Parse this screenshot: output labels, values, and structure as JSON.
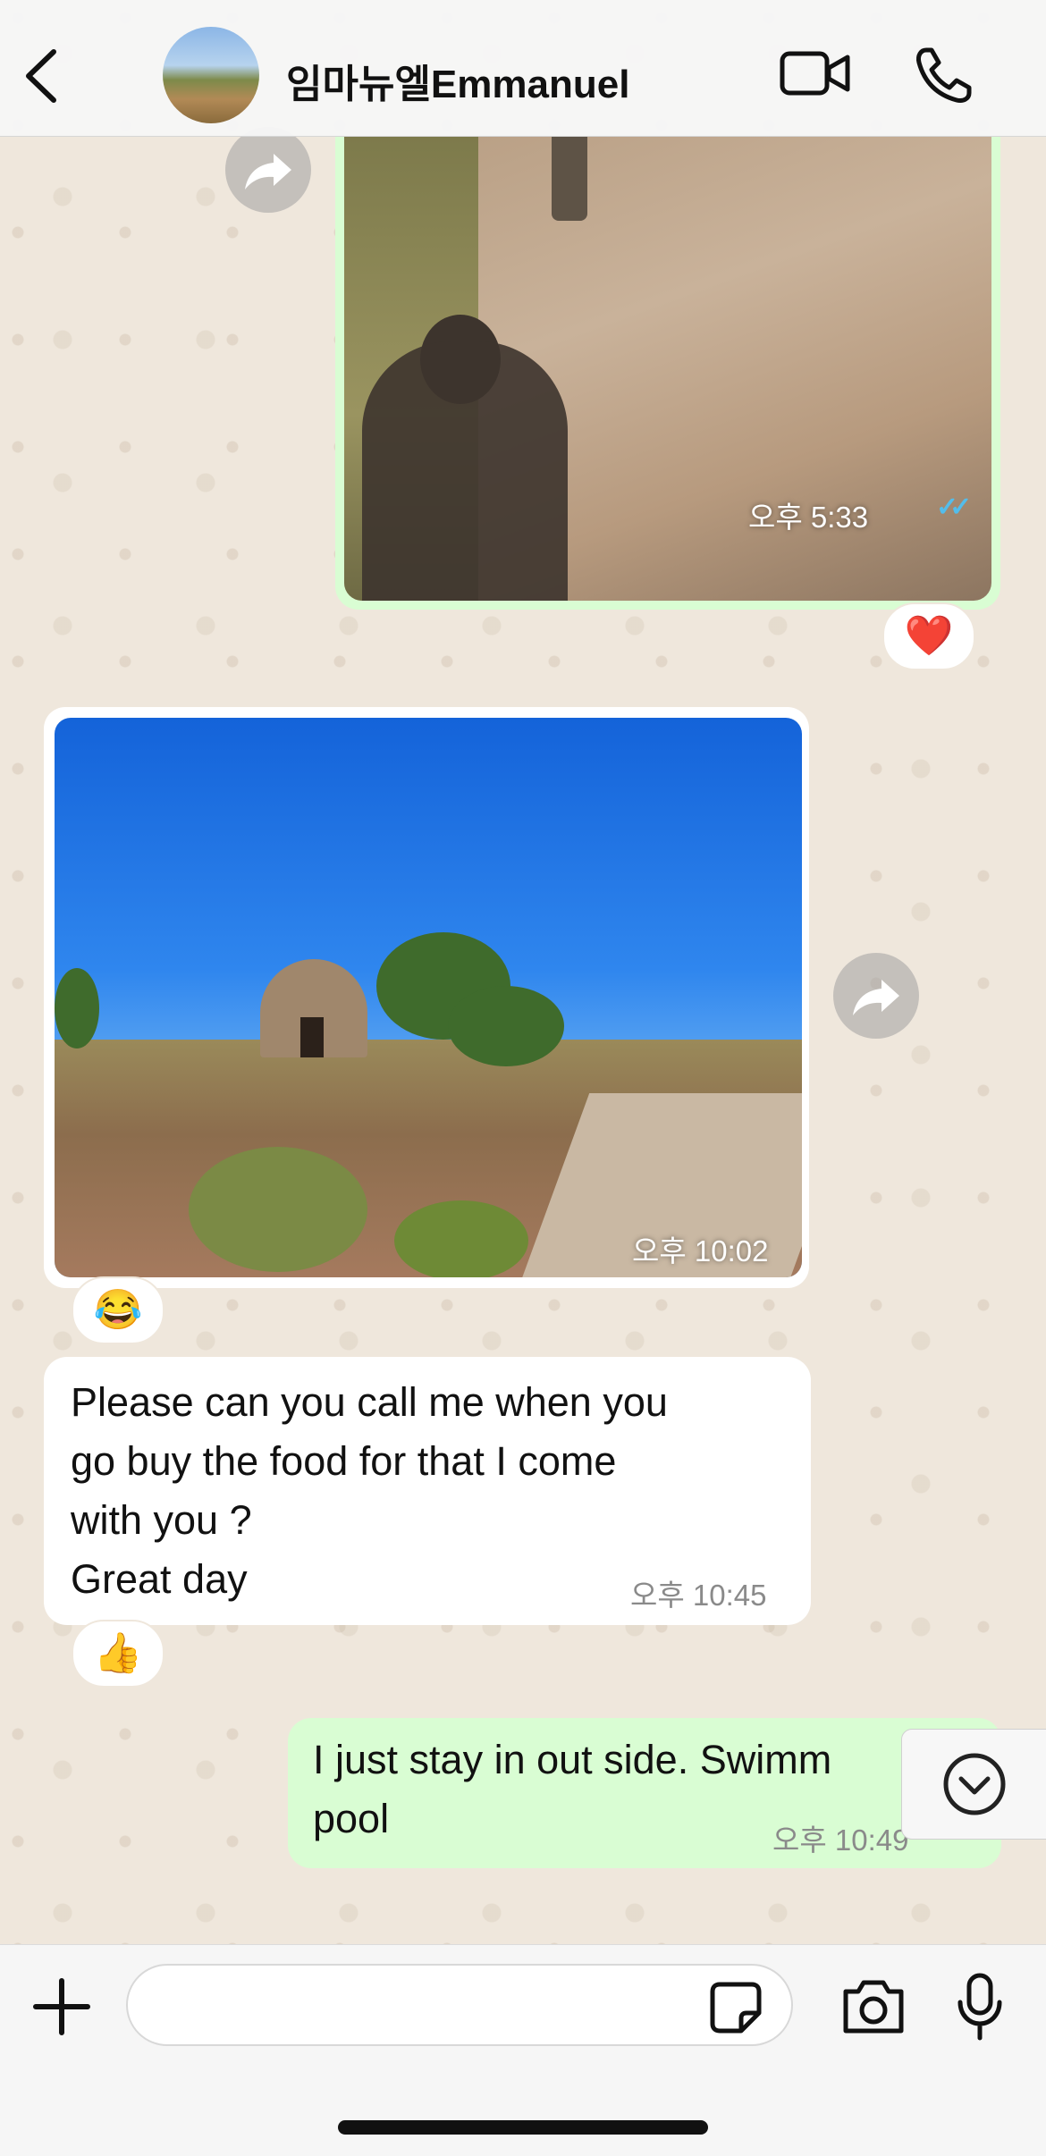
{
  "header": {
    "contact_name": "임마뉴엘Emmanuel"
  },
  "messages": {
    "photo_out": {
      "time": "오후 5:33",
      "status": "read",
      "reaction": "❤️"
    },
    "photo_in": {
      "time": "오후 10:02",
      "reaction": "😂"
    },
    "text_in": {
      "text": "Please can you call me when you\ngo buy the food for that I come\nwith you ?\nGreat day",
      "time": "오후 10:45",
      "reaction": "👍"
    },
    "text_out": {
      "text": "I just stay in out side. Swimm\npool",
      "time": "오후 10:49",
      "status": "read"
    }
  },
  "composer": {
    "input_value": "",
    "input_placeholder": ""
  },
  "colors": {
    "outgoing_bubble": "#d9fdd3",
    "incoming_bubble": "#ffffff",
    "read_ticks": "#53bdeb",
    "wallpaper": "#efe7dc"
  },
  "icons": [
    "back-icon",
    "video-call-icon",
    "phone-icon",
    "forward-icon",
    "chevron-down-icon",
    "plus-icon",
    "sticker-icon",
    "camera-icon",
    "microphone-icon"
  ]
}
